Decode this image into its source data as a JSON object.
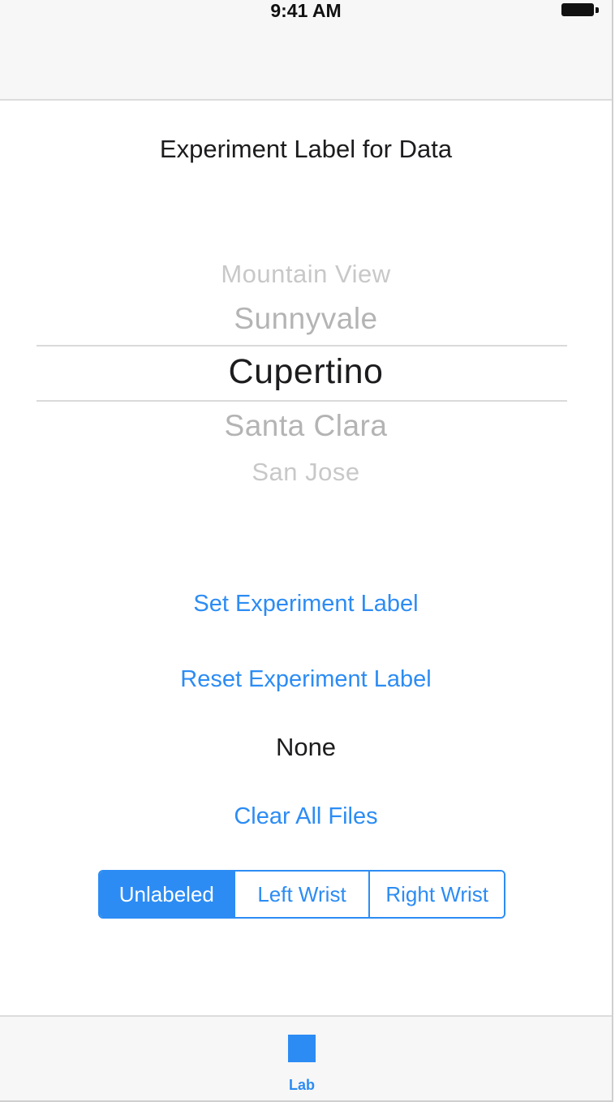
{
  "status_bar": {
    "time": "9:41 AM",
    "battery_icon": "battery-full-icon"
  },
  "header": {
    "title": "Experiment Label for Data"
  },
  "picker": {
    "items": [
      "Mountain View",
      "Sunnyvale",
      "Cupertino",
      "Santa Clara",
      "San Jose"
    ],
    "selected": "Cupertino"
  },
  "actions": {
    "set_label": "Set Experiment Label",
    "reset_label": "Reset Experiment Label",
    "current_label": "None",
    "clear_files": "Clear All Files"
  },
  "segmented_control": {
    "segments": [
      "Unlabeled",
      "Left Wrist",
      "Right Wrist"
    ],
    "selected": "Unlabeled"
  },
  "tab_bar": {
    "tabs": [
      {
        "label": "Lab",
        "icon": "square-icon",
        "selected": true
      }
    ]
  },
  "colors": {
    "accent": "#2c8cf4",
    "text": "#1c1c1e",
    "picker_faded": "#b4b4b4",
    "bar_background": "#f7f7f7"
  }
}
